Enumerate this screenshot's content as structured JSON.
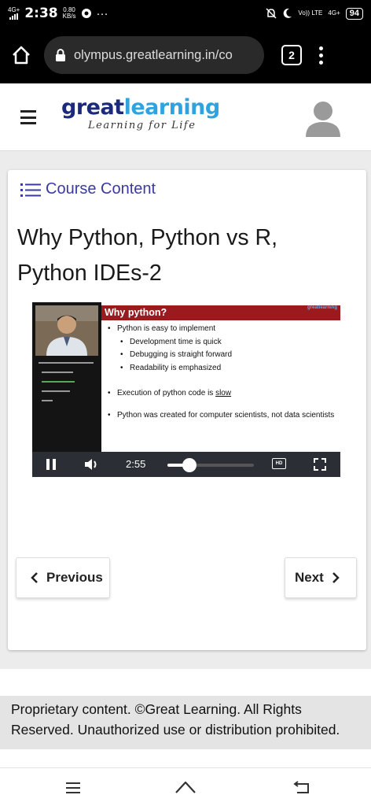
{
  "status_bar": {
    "network": "4G+",
    "time": "2:38",
    "speed_value": "0.80",
    "speed_unit": "KB/s",
    "more": "···",
    "volte": "Vo)) LTE",
    "network2": "4G+",
    "battery": "94"
  },
  "browser": {
    "url": "olympus.greatlearning.in/co",
    "tab_count": "2"
  },
  "site": {
    "brand_great": "great",
    "brand_learning": "learning",
    "tagline": "Learning for Life"
  },
  "course": {
    "course_content_label": "Course Content",
    "lesson_title": "Why Python, Python vs R, Python IDEs-2"
  },
  "video": {
    "slide_title": "Why python?",
    "slide_logo": "greatlearning",
    "bullets": {
      "b1": "Python is easy to implement",
      "b1a": "Development time is quick",
      "b1b": "Debugging is straight forward",
      "b1c": "Readability is emphasized",
      "b2_prefix": "Execution of python code is ",
      "b2_underlined": "slow",
      "b3": "Python was created for computer scientists, not data scientists"
    },
    "current_time": "2:55",
    "progress_fraction": 0.25,
    "hd_label": "HD"
  },
  "nav": {
    "previous_label": "Previous",
    "next_label": "Next"
  },
  "footer": {
    "notice": "Proprietary content. ©Great Learning. All Rights Reserved. Unauthorized use or distribution prohibited."
  },
  "colors": {
    "brand_navy": "#1b2a7a",
    "brand_blue": "#2fa3e0",
    "link_purple": "#3a3aa0",
    "slide_red": "#9b1a1e"
  },
  "icons": [
    "home-icon",
    "lock-icon",
    "kebab-menu-icon",
    "hamburger-icon",
    "avatar-icon",
    "list-icon",
    "pause-icon",
    "volume-icon",
    "fullscreen-icon",
    "chevron-left-icon",
    "chevron-right-icon",
    "nav-recents-icon",
    "nav-home-icon",
    "nav-back-icon"
  ]
}
